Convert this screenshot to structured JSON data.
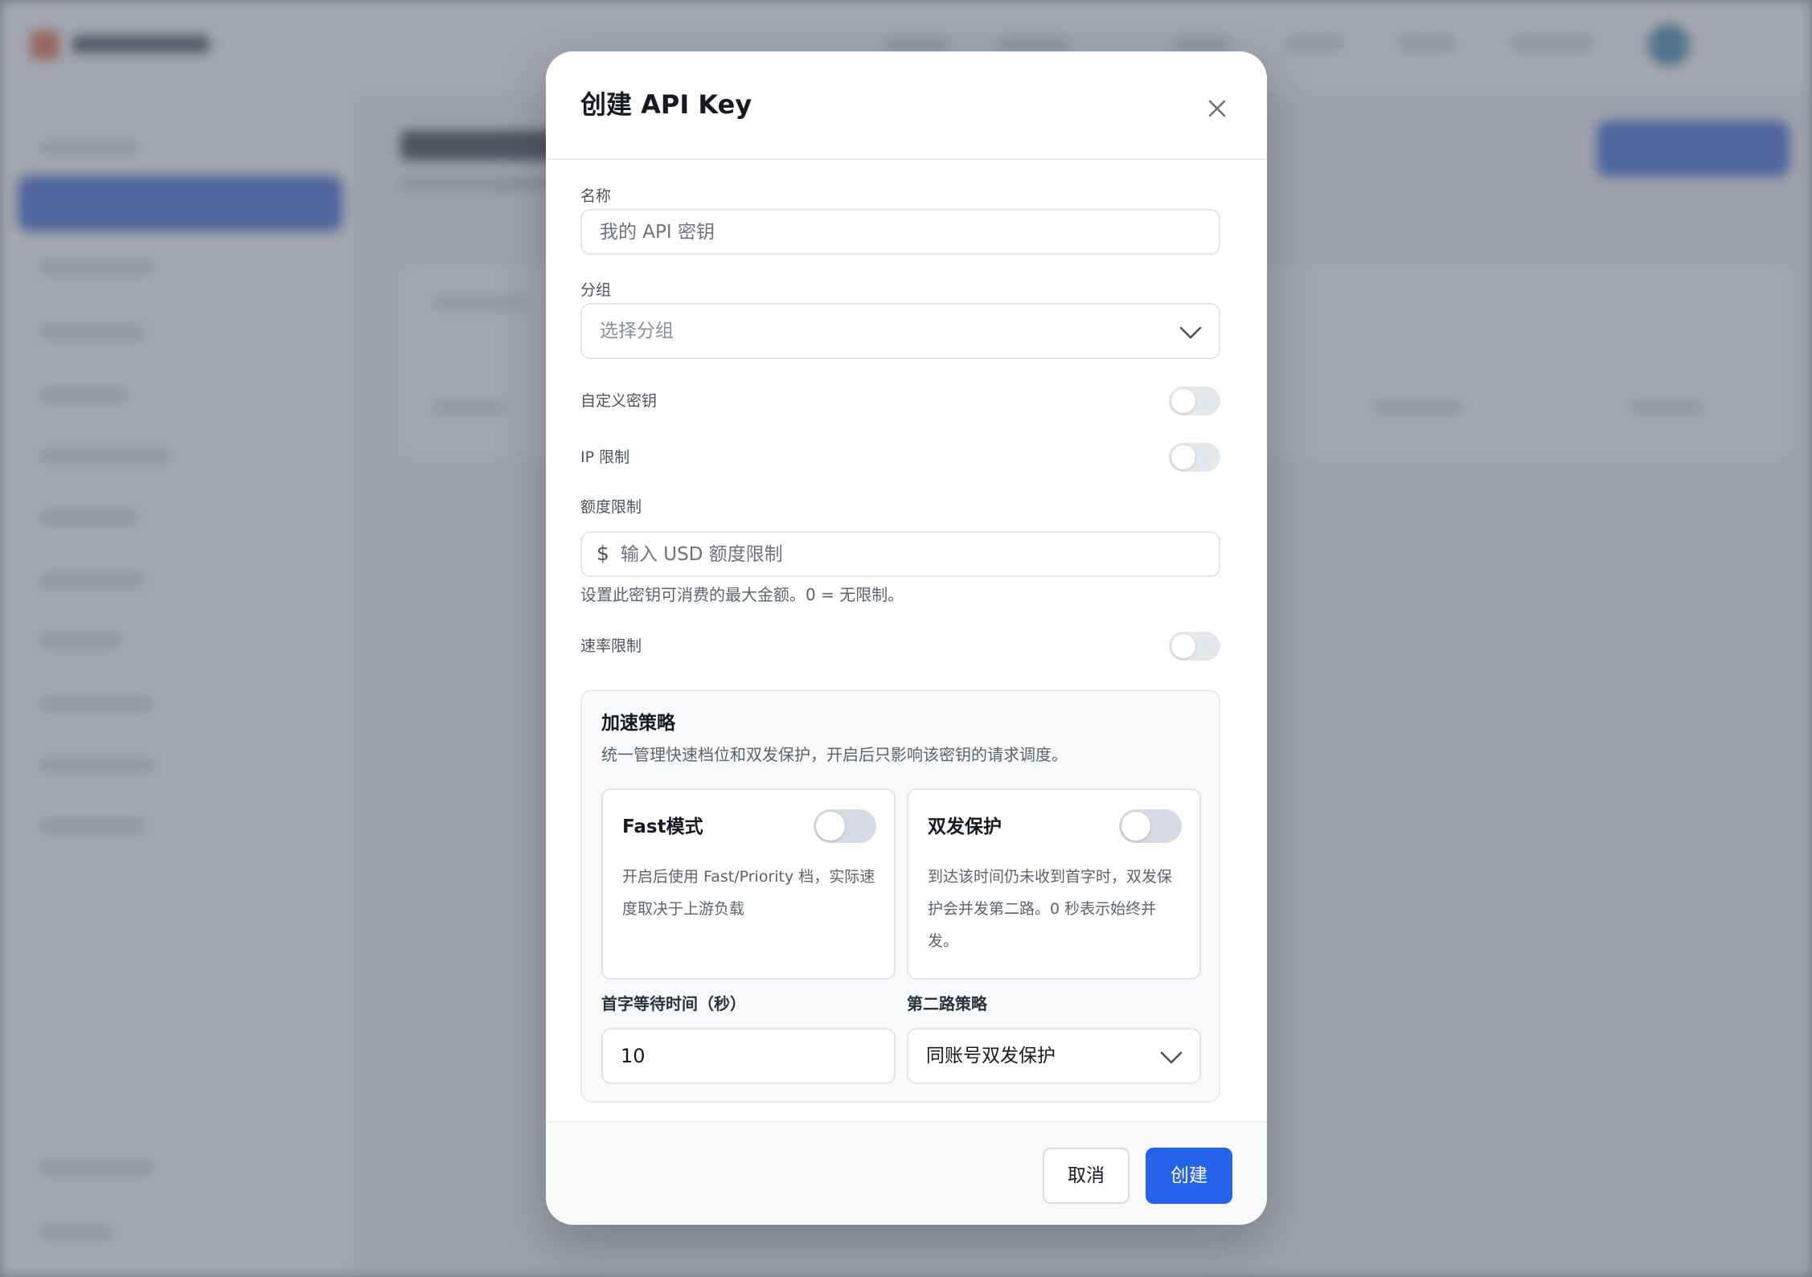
{
  "modal": {
    "title": "创建 API Key",
    "name": {
      "label": "名称",
      "placeholder": "我的 API 密钥"
    },
    "group": {
      "label": "分组",
      "placeholder": "选择分组"
    },
    "custom_key": {
      "label": "自定义密钥",
      "enabled": false
    },
    "ip_limit": {
      "label": "IP 限制",
      "enabled": false
    },
    "quota": {
      "label": "额度限制",
      "currency_symbol": "$",
      "placeholder": "输入 USD 额度限制",
      "helper": "设置此密钥可消费的最大金额。0 = 无限制。"
    },
    "rate_limit": {
      "label": "速率限制",
      "enabled": false
    },
    "acceleration": {
      "title": "加速策略",
      "description": "统一管理快速档位和双发保护，开启后只影响该密钥的请求调度。",
      "fast_mode": {
        "title": "Fast模式",
        "description": "开启后使用 Fast/Priority 档，实际速度取决于上游负载",
        "enabled": false
      },
      "dual_protection": {
        "title": "双发保护",
        "description": "到达该时间仍未收到首字时，双发保护会并发第二路。0 秒表示始终并发。",
        "enabled": false
      },
      "first_token_wait": {
        "label": "首字等待时间（秒）",
        "value": "10"
      },
      "second_route": {
        "label": "第二路策略",
        "value": "同账号双发保护"
      }
    },
    "footer": {
      "cancel_label": "取消",
      "create_label": "创建"
    }
  },
  "icons": {
    "close": "close-icon",
    "chevron": "chevron-down-icon"
  },
  "colors": {
    "primary": "#2563eb",
    "toggle_off": "#e4e7ec"
  }
}
